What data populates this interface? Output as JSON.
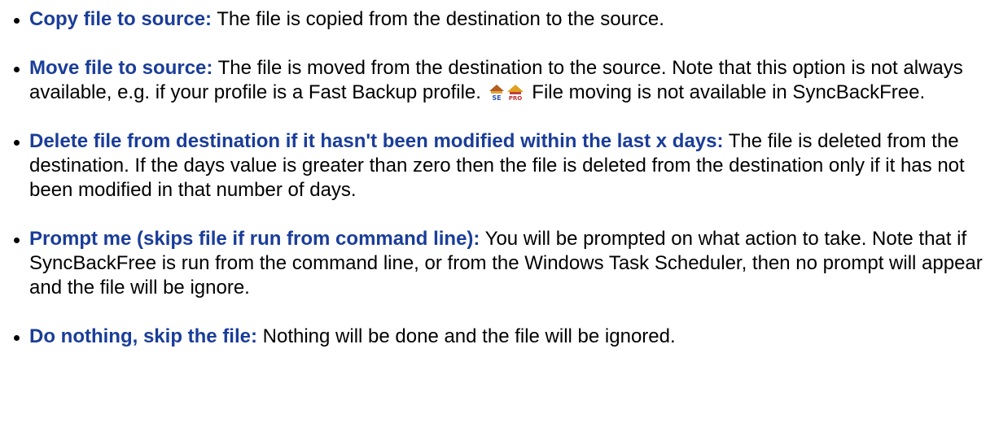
{
  "colors": {
    "term": "#1a3d99",
    "body_text": "#000000",
    "background": "#ffffff"
  },
  "options": [
    {
      "term": "Copy file to source:",
      "description": " The file is copied from the destination to the source."
    },
    {
      "term": "Move file to source:",
      "description_before_icons": " The file is moved from the destination to the source. Note that this option is not always available, e.g. if your profile is a Fast Backup profile. ",
      "icons": [
        "se-edition-icon",
        "pro-edition-icon"
      ],
      "description_after_icons": " File moving is not available in SyncBackFree."
    },
    {
      "term": "Delete file from destination if it hasn't been modified within the last x days:",
      "description": " The file is deleted from the destination. If the days value is greater than zero then the file is deleted from the destination only if it has not been modified in that number of days."
    },
    {
      "term": "Prompt me (skips file if run from command line):",
      "description": " You will be prompted on what action to take. Note that if SyncBackFree is run from the command line, or from the Windows Task Scheduler, then no prompt will appear and the file will be ignore."
    },
    {
      "term": "Do nothing, skip the file:",
      "description": " Nothing will be done and the file will be ignored."
    }
  ]
}
